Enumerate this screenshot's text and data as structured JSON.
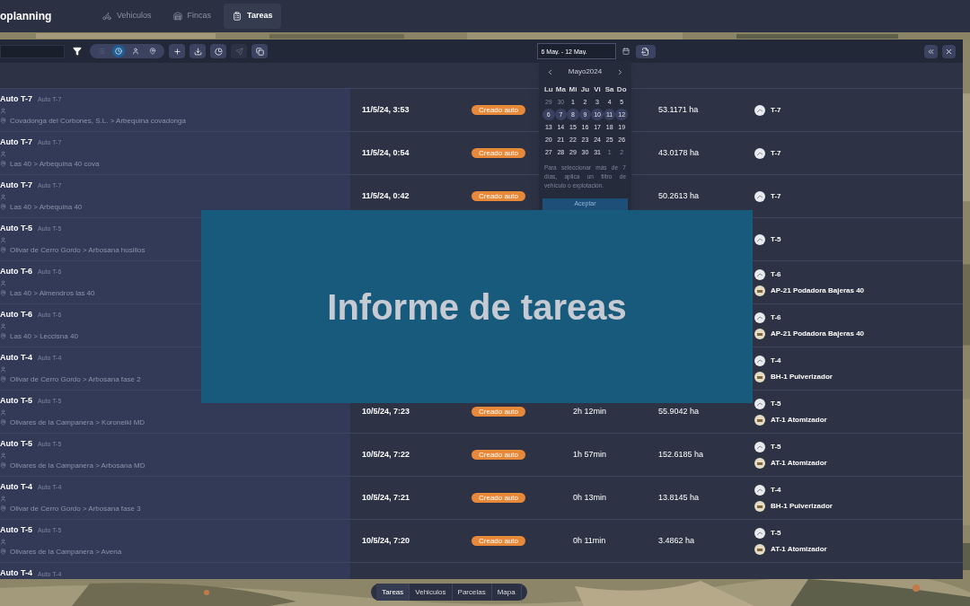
{
  "header": {
    "brand": "oplanning",
    "tabs": [
      {
        "kind": "vehicles",
        "label": "Vehiculos",
        "selected": false
      },
      {
        "kind": "farms",
        "label": "Fincas",
        "selected": false
      },
      {
        "kind": "tasks",
        "label": "Tareas",
        "selected": true
      }
    ]
  },
  "toolbar": {
    "view_modes": [
      {
        "kind": "list",
        "selected": false
      },
      {
        "kind": "clock",
        "selected": true
      },
      {
        "kind": "person",
        "selected": false
      },
      {
        "kind": "pin",
        "selected": false
      }
    ],
    "actions": [
      {
        "kind": "add",
        "disabled": false
      },
      {
        "kind": "download",
        "disabled": false
      },
      {
        "kind": "chart",
        "disabled": false
      },
      {
        "kind": "send",
        "disabled": true
      },
      {
        "kind": "copy",
        "disabled": false
      }
    ],
    "date_range": {
      "value": "6 May. - 12 May."
    }
  },
  "calendar": {
    "month": "Mayo2024",
    "weekdays": [
      "Lu",
      "Ma",
      "Mi",
      "Ju",
      "Vi",
      "Sa",
      "Do"
    ],
    "days": [
      {
        "label": "29",
        "muted": true,
        "selected": false
      },
      {
        "label": "30",
        "muted": true,
        "selected": false
      },
      {
        "label": "1",
        "muted": false,
        "selected": false
      },
      {
        "label": "2",
        "muted": false,
        "selected": false
      },
      {
        "label": "3",
        "muted": false,
        "selected": false
      },
      {
        "label": "4",
        "muted": false,
        "selected": false
      },
      {
        "label": "5",
        "muted": false,
        "selected": false
      },
      {
        "label": "6",
        "muted": false,
        "selected": true
      },
      {
        "label": "7",
        "muted": false,
        "selected": true
      },
      {
        "label": "8",
        "muted": false,
        "selected": true
      },
      {
        "label": "9",
        "muted": false,
        "selected": true
      },
      {
        "label": "10",
        "muted": false,
        "selected": true
      },
      {
        "label": "11",
        "muted": false,
        "selected": true
      },
      {
        "label": "12",
        "muted": false,
        "selected": true
      },
      {
        "label": "13",
        "muted": false,
        "selected": false
      },
      {
        "label": "14",
        "muted": false,
        "selected": false
      },
      {
        "label": "15",
        "muted": false,
        "selected": false
      },
      {
        "label": "16",
        "muted": false,
        "selected": false
      },
      {
        "label": "17",
        "muted": false,
        "selected": false
      },
      {
        "label": "18",
        "muted": false,
        "selected": false
      },
      {
        "label": "19",
        "muted": false,
        "selected": false
      },
      {
        "label": "20",
        "muted": false,
        "selected": false
      },
      {
        "label": "21",
        "muted": false,
        "selected": false
      },
      {
        "label": "22",
        "muted": false,
        "selected": false
      },
      {
        "label": "23",
        "muted": false,
        "selected": false
      },
      {
        "label": "24",
        "muted": false,
        "selected": false
      },
      {
        "label": "25",
        "muted": false,
        "selected": false
      },
      {
        "label": "26",
        "muted": false,
        "selected": false
      },
      {
        "label": "27",
        "muted": false,
        "selected": false
      },
      {
        "label": "28",
        "muted": false,
        "selected": false
      },
      {
        "label": "29",
        "muted": false,
        "selected": false
      },
      {
        "label": "30",
        "muted": false,
        "selected": false
      },
      {
        "label": "31",
        "muted": false,
        "selected": false
      },
      {
        "label": "1",
        "muted": true,
        "selected": false
      },
      {
        "label": "2",
        "muted": true,
        "selected": false
      }
    ],
    "hint": "Para seleccionar más de 7 días, aplica un filtro de vehículo o explotación.",
    "accept": "Aceptar"
  },
  "rows": [
    {
      "name": "Auto T-7",
      "subtitle": "Auto T-7",
      "location": "Covadonga del Corbones, S.L. > Arbequina covadonga",
      "date": "11/5/24, 3:53",
      "status": "Creado auto",
      "area": "53.1171 ha",
      "equipment": [
        {
          "kind": "vehicle",
          "label": "T-7"
        }
      ]
    },
    {
      "name": "Auto T-7",
      "subtitle": "Auto T-7",
      "location": "Las 40 > Arbequina 40 cova",
      "date": "11/5/24, 0:54",
      "status": "Creado auto",
      "area": "43.0178 ha",
      "equipment": [
        {
          "kind": "vehicle",
          "label": "T-7"
        }
      ]
    },
    {
      "name": "Auto T-7",
      "subtitle": "Auto T-7",
      "location": "Las 40 > Arbequina 40",
      "date": "11/5/24, 0:42",
      "status": "Creado auto",
      "area": "50.2613 ha",
      "equipment": [
        {
          "kind": "vehicle",
          "label": "T-7"
        }
      ]
    },
    {
      "name": "Auto T-5",
      "subtitle": "Auto T-5",
      "location": "Olivar de Cerro Gordo > Arbosana husillos",
      "equipment": [
        {
          "kind": "vehicle",
          "label": "T-5"
        }
      ]
    },
    {
      "name": "Auto T-6",
      "subtitle": "Auto T-6",
      "location": "Las 40 > Almendros las 40",
      "equipment": [
        {
          "kind": "vehicle",
          "label": "T-6"
        },
        {
          "kind": "implement",
          "label": "AP-21 Podadora Bajeras 40"
        }
      ]
    },
    {
      "name": "Auto T-6",
      "subtitle": "Auto T-6",
      "location": "Las 40 > Leccisna 40",
      "equipment": [
        {
          "kind": "vehicle",
          "label": "T-6"
        },
        {
          "kind": "implement",
          "label": "AP-21 Podadora Bajeras 40"
        }
      ]
    },
    {
      "name": "Auto T-4",
      "subtitle": "Auto T-4",
      "location": "Olivar de Cerro Gordo > Arbosana fase 2",
      "equipment": [
        {
          "kind": "vehicle",
          "label": "T-4"
        },
        {
          "kind": "implement",
          "label": "BH-1 Pulverizador"
        }
      ]
    },
    {
      "name": "Auto T-5",
      "subtitle": "Auto T-5",
      "location": "Olivares de la Campanera > Koroneiki MD",
      "date": "10/5/24, 7:23",
      "status": "Creado auto",
      "duration": "2h 12min",
      "area": "55.9042 ha",
      "equipment": [
        {
          "kind": "vehicle",
          "label": "T-5"
        },
        {
          "kind": "implement",
          "label": "AT-1 Atomizador"
        }
      ]
    },
    {
      "name": "Auto T-5",
      "subtitle": "Auto T-5",
      "location": "Olivares de la Campanera > Arbosana MD",
      "date": "10/5/24, 7:22",
      "status": "Creado auto",
      "duration": "1h 57min",
      "area": "152.6185 ha",
      "equipment": [
        {
          "kind": "vehicle",
          "label": "T-5"
        },
        {
          "kind": "implement",
          "label": "AT-1 Atomizador"
        }
      ]
    },
    {
      "name": "Auto T-4",
      "subtitle": "Auto T-4",
      "location": "Olivar de Cerro Gordo > Arbosana fase 3",
      "date": "10/5/24, 7:21",
      "status": "Creado auto",
      "duration": "0h 13min",
      "area": "13.8145 ha",
      "equipment": [
        {
          "kind": "vehicle",
          "label": "T-4"
        },
        {
          "kind": "implement",
          "label": "BH-1 Pulverizador"
        }
      ]
    },
    {
      "name": "Auto T-5",
      "subtitle": "Auto T-5",
      "location": "Olivares de la Campanera > Avena",
      "date": "10/5/24, 7:20",
      "status": "Creado auto",
      "duration": "0h 11min",
      "area": "3.4862 ha",
      "equipment": [
        {
          "kind": "vehicle",
          "label": "T-5"
        },
        {
          "kind": "implement",
          "label": "AT-1 Atomizador"
        }
      ]
    },
    {
      "name": "Auto T-4",
      "subtitle": "Auto T-4"
    }
  ],
  "bottom_nav": [
    {
      "label": "Tareas",
      "selected": true
    },
    {
      "label": "Vehiculos",
      "selected": false
    },
    {
      "label": "Parcelas",
      "selected": false
    },
    {
      "label": "Mapa",
      "selected": false
    }
  ],
  "banner": {
    "title": "Informe de tareas"
  }
}
